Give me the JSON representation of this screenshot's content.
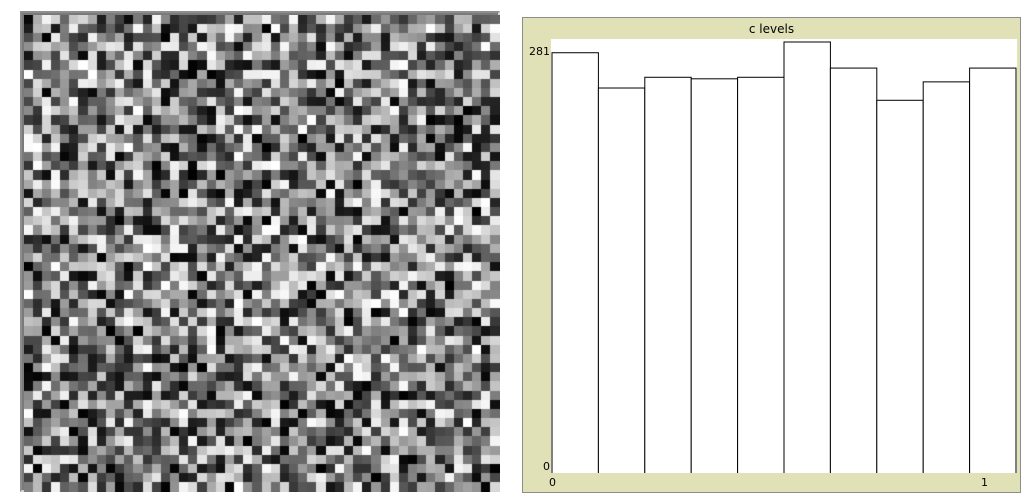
{
  "world": {
    "patch_columns": 52,
    "patch_rows": 52
  },
  "plot": {
    "title": "c levels",
    "background": "#e1e1b7",
    "y_max_label": "281",
    "y_min_label": "0",
    "x_min_label": "0",
    "x_max_label": "1"
  },
  "chart_data": {
    "type": "bar",
    "title": "c levels",
    "xlim": [
      0,
      1
    ],
    "ylim": [
      0,
      281
    ],
    "bin_edges": [
      0,
      0.1,
      0.2,
      0.3,
      0.4,
      0.5,
      0.6,
      0.7,
      0.8,
      0.9,
      1.0
    ],
    "values": [
      274,
      251,
      258,
      257,
      258,
      281,
      264,
      243,
      255,
      264
    ]
  }
}
